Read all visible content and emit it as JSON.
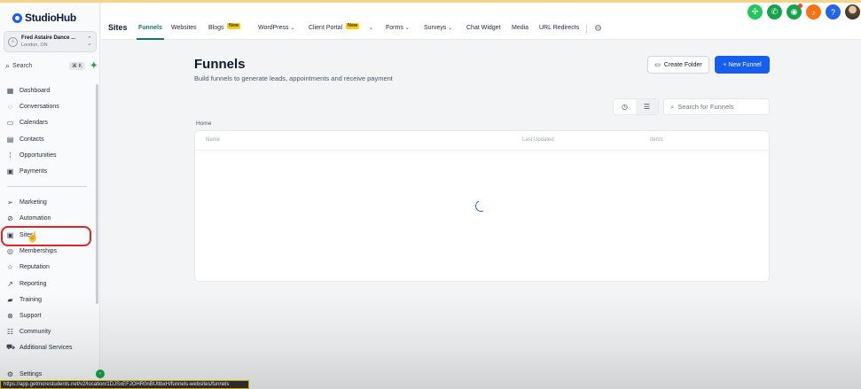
{
  "brand": {
    "logo_text": "StudioHub",
    "accent": "#155eef",
    "teal": "#0f766e"
  },
  "location": {
    "name": "Fred Astaire Dance ...",
    "city": "London, ON"
  },
  "sidebar": {
    "search_label": "Search",
    "shortcut": "⌘ K",
    "items": [
      {
        "label": "Dashboard",
        "icon": "grid-icon"
      },
      {
        "label": "Conversations",
        "icon": "chat-icon"
      },
      {
        "label": "Calendars",
        "icon": "calendar-icon"
      },
      {
        "label": "Contacts",
        "icon": "contacts-icon"
      },
      {
        "label": "Opportunities",
        "icon": "pipeline-icon"
      },
      {
        "label": "Payments",
        "icon": "payments-icon"
      },
      {
        "label": "Marketing",
        "icon": "send-icon"
      },
      {
        "label": "Automation",
        "icon": "automation-icon"
      },
      {
        "label": "Sites",
        "icon": "sites-icon",
        "highlighted": true
      },
      {
        "label": "Memberships",
        "icon": "membership-icon"
      },
      {
        "label": "Reputation",
        "icon": "star-icon"
      },
      {
        "label": "Reporting",
        "icon": "reporting-icon"
      },
      {
        "label": "Training",
        "icon": "book-icon"
      },
      {
        "label": "Support",
        "icon": "support-icon"
      },
      {
        "label": "Community",
        "icon": "community-icon"
      },
      {
        "label": "Additional Services",
        "icon": "cart-icon"
      },
      {
        "label": "Settings",
        "icon": "gear-icon"
      }
    ]
  },
  "topnav": {
    "section_title": "Sites",
    "tabs": [
      {
        "label": "Funnels",
        "active": true
      },
      {
        "label": "Websites"
      },
      {
        "label": "Blogs",
        "badge": "New"
      },
      {
        "label": "WordPress",
        "dropdown": true
      },
      {
        "label": "Client Portal",
        "badge": "New",
        "dropdown": true
      },
      {
        "label": "Forms",
        "dropdown": true
      },
      {
        "label": "Surveys",
        "dropdown": true
      },
      {
        "label": "Chat Widget"
      },
      {
        "label": "Media"
      },
      {
        "label": "URL Redirects"
      }
    ]
  },
  "main": {
    "title": "Funnels",
    "subtitle": "Build funnels to generate leads, appointments and receive payment",
    "create_folder_label": "Create Folder",
    "new_funnel_label": "+ New Funnel",
    "search_placeholder": "Search for Funnels",
    "breadcrumb": "Home",
    "columns": [
      "Name",
      "Last Updated",
      "Items"
    ]
  },
  "status_url": "https://app.getmorestudents.net/v2/location/1DJSxEFJOHR0nBUttbxH/funnels-websites/funnels"
}
